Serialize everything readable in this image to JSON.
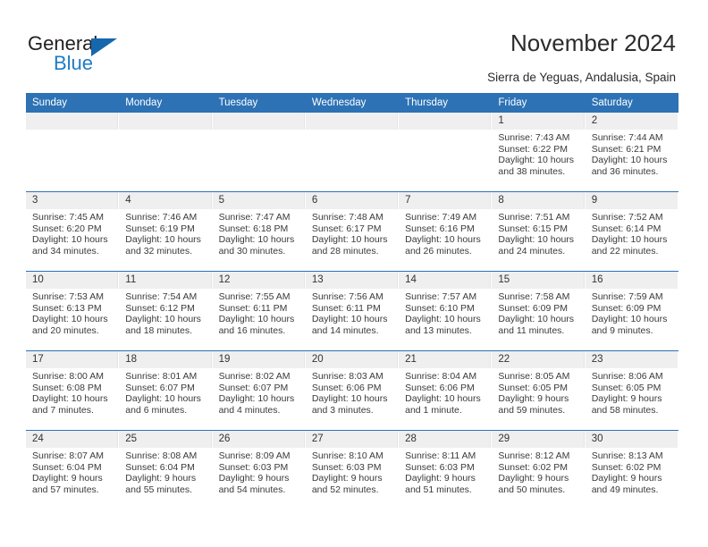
{
  "brand": {
    "name_top": "General",
    "name_bottom": "Blue",
    "triangle_color": "#1668ad",
    "blue_text_color": "#1f7cc4"
  },
  "header": {
    "title": "November 2024",
    "subtitle": "Sierra de Yeguas, Andalusia, Spain"
  },
  "theme": {
    "header_blue": "#2d72b5",
    "date_band_gray": "#efefef",
    "text_color": "#3a3a3a"
  },
  "labels": {
    "sunrise_prefix": "Sunrise:",
    "sunset_prefix": "Sunset:",
    "daylight_prefix": "Daylight:"
  },
  "weekdays": [
    "Sunday",
    "Monday",
    "Tuesday",
    "Wednesday",
    "Thursday",
    "Friday",
    "Saturday"
  ],
  "weeks": [
    [
      {
        "day": "",
        "empty": true
      },
      {
        "day": "",
        "empty": true
      },
      {
        "day": "",
        "empty": true
      },
      {
        "day": "",
        "empty": true
      },
      {
        "day": "",
        "empty": true
      },
      {
        "day": "1",
        "sunrise": "Sunrise: 7:43 AM",
        "sunset": "Sunset: 6:22 PM",
        "daylight_l1": "Daylight: 10 hours",
        "daylight_l2": "and 38 minutes."
      },
      {
        "day": "2",
        "sunrise": "Sunrise: 7:44 AM",
        "sunset": "Sunset: 6:21 PM",
        "daylight_l1": "Daylight: 10 hours",
        "daylight_l2": "and 36 minutes."
      }
    ],
    [
      {
        "day": "3",
        "sunrise": "Sunrise: 7:45 AM",
        "sunset": "Sunset: 6:20 PM",
        "daylight_l1": "Daylight: 10 hours",
        "daylight_l2": "and 34 minutes."
      },
      {
        "day": "4",
        "sunrise": "Sunrise: 7:46 AM",
        "sunset": "Sunset: 6:19 PM",
        "daylight_l1": "Daylight: 10 hours",
        "daylight_l2": "and 32 minutes."
      },
      {
        "day": "5",
        "sunrise": "Sunrise: 7:47 AM",
        "sunset": "Sunset: 6:18 PM",
        "daylight_l1": "Daylight: 10 hours",
        "daylight_l2": "and 30 minutes."
      },
      {
        "day": "6",
        "sunrise": "Sunrise: 7:48 AM",
        "sunset": "Sunset: 6:17 PM",
        "daylight_l1": "Daylight: 10 hours",
        "daylight_l2": "and 28 minutes."
      },
      {
        "day": "7",
        "sunrise": "Sunrise: 7:49 AM",
        "sunset": "Sunset: 6:16 PM",
        "daylight_l1": "Daylight: 10 hours",
        "daylight_l2": "and 26 minutes."
      },
      {
        "day": "8",
        "sunrise": "Sunrise: 7:51 AM",
        "sunset": "Sunset: 6:15 PM",
        "daylight_l1": "Daylight: 10 hours",
        "daylight_l2": "and 24 minutes."
      },
      {
        "day": "9",
        "sunrise": "Sunrise: 7:52 AM",
        "sunset": "Sunset: 6:14 PM",
        "daylight_l1": "Daylight: 10 hours",
        "daylight_l2": "and 22 minutes."
      }
    ],
    [
      {
        "day": "10",
        "sunrise": "Sunrise: 7:53 AM",
        "sunset": "Sunset: 6:13 PM",
        "daylight_l1": "Daylight: 10 hours",
        "daylight_l2": "and 20 minutes."
      },
      {
        "day": "11",
        "sunrise": "Sunrise: 7:54 AM",
        "sunset": "Sunset: 6:12 PM",
        "daylight_l1": "Daylight: 10 hours",
        "daylight_l2": "and 18 minutes."
      },
      {
        "day": "12",
        "sunrise": "Sunrise: 7:55 AM",
        "sunset": "Sunset: 6:11 PM",
        "daylight_l1": "Daylight: 10 hours",
        "daylight_l2": "and 16 minutes."
      },
      {
        "day": "13",
        "sunrise": "Sunrise: 7:56 AM",
        "sunset": "Sunset: 6:11 PM",
        "daylight_l1": "Daylight: 10 hours",
        "daylight_l2": "and 14 minutes."
      },
      {
        "day": "14",
        "sunrise": "Sunrise: 7:57 AM",
        "sunset": "Sunset: 6:10 PM",
        "daylight_l1": "Daylight: 10 hours",
        "daylight_l2": "and 13 minutes."
      },
      {
        "day": "15",
        "sunrise": "Sunrise: 7:58 AM",
        "sunset": "Sunset: 6:09 PM",
        "daylight_l1": "Daylight: 10 hours",
        "daylight_l2": "and 11 minutes."
      },
      {
        "day": "16",
        "sunrise": "Sunrise: 7:59 AM",
        "sunset": "Sunset: 6:09 PM",
        "daylight_l1": "Daylight: 10 hours",
        "daylight_l2": "and 9 minutes."
      }
    ],
    [
      {
        "day": "17",
        "sunrise": "Sunrise: 8:00 AM",
        "sunset": "Sunset: 6:08 PM",
        "daylight_l1": "Daylight: 10 hours",
        "daylight_l2": "and 7 minutes."
      },
      {
        "day": "18",
        "sunrise": "Sunrise: 8:01 AM",
        "sunset": "Sunset: 6:07 PM",
        "daylight_l1": "Daylight: 10 hours",
        "daylight_l2": "and 6 minutes."
      },
      {
        "day": "19",
        "sunrise": "Sunrise: 8:02 AM",
        "sunset": "Sunset: 6:07 PM",
        "daylight_l1": "Daylight: 10 hours",
        "daylight_l2": "and 4 minutes."
      },
      {
        "day": "20",
        "sunrise": "Sunrise: 8:03 AM",
        "sunset": "Sunset: 6:06 PM",
        "daylight_l1": "Daylight: 10 hours",
        "daylight_l2": "and 3 minutes."
      },
      {
        "day": "21",
        "sunrise": "Sunrise: 8:04 AM",
        "sunset": "Sunset: 6:06 PM",
        "daylight_l1": "Daylight: 10 hours",
        "daylight_l2": "and 1 minute."
      },
      {
        "day": "22",
        "sunrise": "Sunrise: 8:05 AM",
        "sunset": "Sunset: 6:05 PM",
        "daylight_l1": "Daylight: 9 hours",
        "daylight_l2": "and 59 minutes."
      },
      {
        "day": "23",
        "sunrise": "Sunrise: 8:06 AM",
        "sunset": "Sunset: 6:05 PM",
        "daylight_l1": "Daylight: 9 hours",
        "daylight_l2": "and 58 minutes."
      }
    ],
    [
      {
        "day": "24",
        "sunrise": "Sunrise: 8:07 AM",
        "sunset": "Sunset: 6:04 PM",
        "daylight_l1": "Daylight: 9 hours",
        "daylight_l2": "and 57 minutes."
      },
      {
        "day": "25",
        "sunrise": "Sunrise: 8:08 AM",
        "sunset": "Sunset: 6:04 PM",
        "daylight_l1": "Daylight: 9 hours",
        "daylight_l2": "and 55 minutes."
      },
      {
        "day": "26",
        "sunrise": "Sunrise: 8:09 AM",
        "sunset": "Sunset: 6:03 PM",
        "daylight_l1": "Daylight: 9 hours",
        "daylight_l2": "and 54 minutes."
      },
      {
        "day": "27",
        "sunrise": "Sunrise: 8:10 AM",
        "sunset": "Sunset: 6:03 PM",
        "daylight_l1": "Daylight: 9 hours",
        "daylight_l2": "and 52 minutes."
      },
      {
        "day": "28",
        "sunrise": "Sunrise: 8:11 AM",
        "sunset": "Sunset: 6:03 PM",
        "daylight_l1": "Daylight: 9 hours",
        "daylight_l2": "and 51 minutes."
      },
      {
        "day": "29",
        "sunrise": "Sunrise: 8:12 AM",
        "sunset": "Sunset: 6:02 PM",
        "daylight_l1": "Daylight: 9 hours",
        "daylight_l2": "and 50 minutes."
      },
      {
        "day": "30",
        "sunrise": "Sunrise: 8:13 AM",
        "sunset": "Sunset: 6:02 PM",
        "daylight_l1": "Daylight: 9 hours",
        "daylight_l2": "and 49 minutes."
      }
    ]
  ]
}
